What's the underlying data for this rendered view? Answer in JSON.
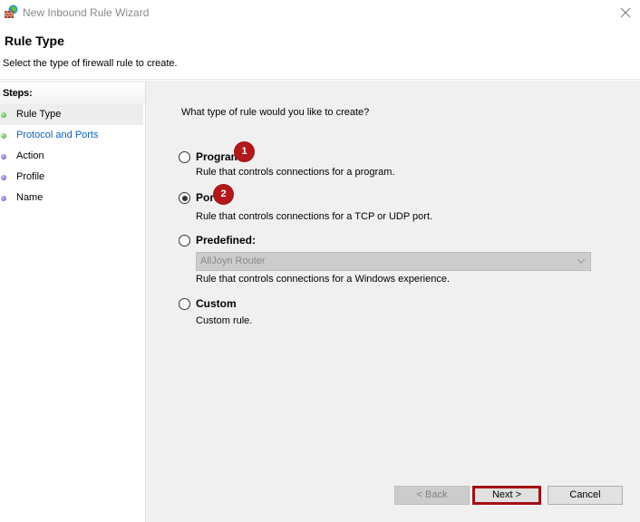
{
  "window": {
    "title": "New Inbound Rule Wizard",
    "icon": "firewall-globe-icon",
    "close_icon": "close-icon"
  },
  "header": {
    "title": "Rule Type",
    "subtitle": "Select the type of firewall rule to create."
  },
  "steps": {
    "heading": "Steps:",
    "items": [
      {
        "label": "Rule Type",
        "status": "complete",
        "active": true
      },
      {
        "label": "Protocol and Ports",
        "status": "complete",
        "active": false
      },
      {
        "label": "Action",
        "status": "pending",
        "active": false
      },
      {
        "label": "Profile",
        "status": "pending",
        "active": false
      },
      {
        "label": "Name",
        "status": "pending",
        "active": false
      }
    ]
  },
  "content": {
    "question": "What type of rule would you like to create?",
    "options": [
      {
        "label": "Program",
        "description": "Rule that controls connections for a program.",
        "checked": false,
        "badge": "1"
      },
      {
        "label": "Port",
        "description": "Rule that controls connections for a TCP or UDP port.",
        "checked": true,
        "badge": "2"
      },
      {
        "label": "Predefined:",
        "description": "Rule that controls connections for a Windows experience.",
        "checked": false
      },
      {
        "label": "Custom",
        "description": "Custom rule.",
        "checked": false
      }
    ],
    "predefined_dropdown": {
      "selected": "AllJoyn Router",
      "enabled": false
    }
  },
  "buttons": {
    "back": "< Back",
    "next": "Next >",
    "cancel": "Cancel"
  },
  "colors": {
    "badge": "#b3191b",
    "highlight_border": "#a31013",
    "link": "#0e5fbf"
  }
}
